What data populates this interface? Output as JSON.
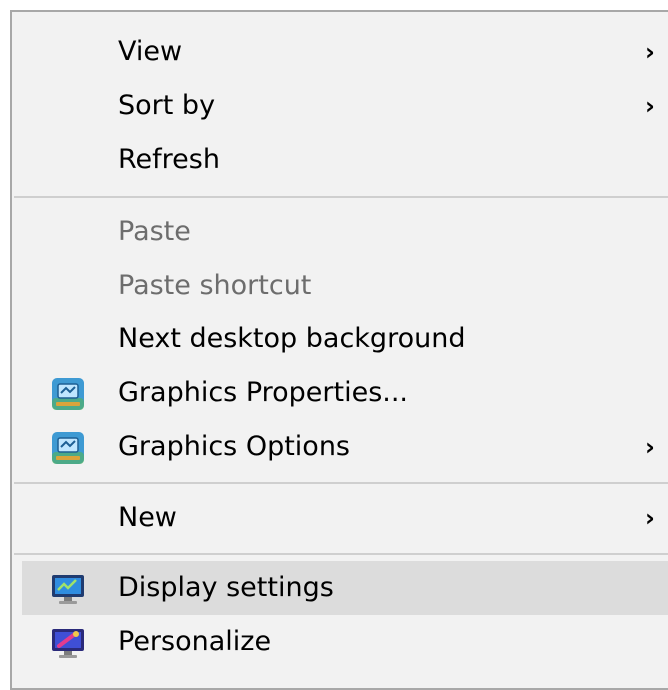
{
  "menu": {
    "items": [
      {
        "label": "View",
        "submenu_glyph": "›"
      },
      {
        "label": "Sort by",
        "submenu_glyph": "›"
      },
      {
        "label": "Refresh"
      },
      {
        "label": "Paste",
        "disabled": true
      },
      {
        "label": "Paste shortcut",
        "disabled": true
      },
      {
        "label": "Next desktop background"
      },
      {
        "label": "Graphics Properties...",
        "icon": "graphics-properties-icon"
      },
      {
        "label": "Graphics Options",
        "icon": "graphics-options-icon",
        "submenu_glyph": "›"
      },
      {
        "label": "New",
        "submenu_glyph": "›"
      },
      {
        "label": "Display settings",
        "icon": "display-settings-icon",
        "hovered": true
      },
      {
        "label": "Personalize",
        "icon": "personalize-icon"
      }
    ]
  },
  "colors": {
    "menu_background": "#f2f2f2",
    "hover_background": "#dcdcdc",
    "disabled_text": "#6d6d6d",
    "separator": "#cfcfcf",
    "border": "#a8a8a8"
  }
}
